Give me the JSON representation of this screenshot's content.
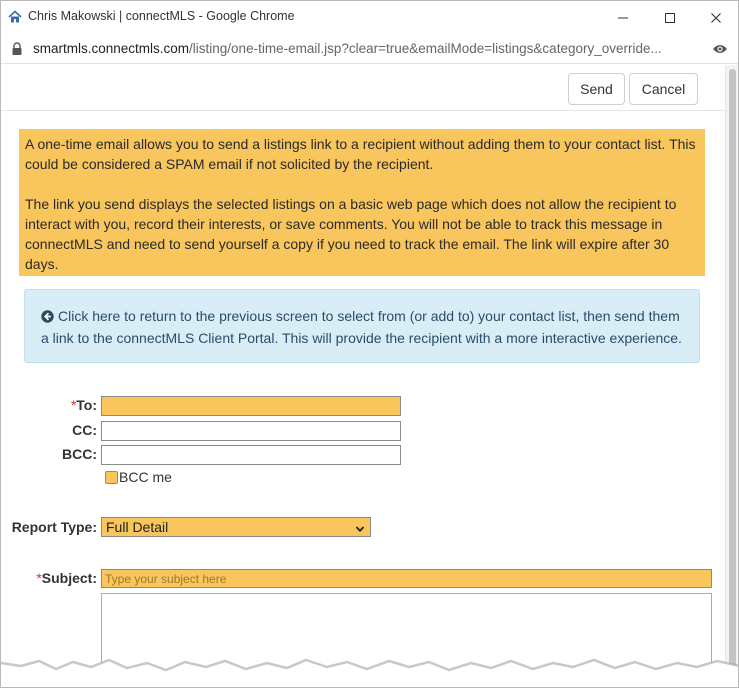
{
  "window": {
    "title": "Chris Makowski | connectMLS - Google Chrome"
  },
  "address": {
    "domain": "smartmls.connectmls.com",
    "path": "/listing/one-time-email.jsp?clear=true&emailMode=listings&category_override..."
  },
  "toolbar": {
    "send_label": "Send",
    "cancel_label": "Cancel"
  },
  "notice": {
    "paragraph1": "A one-time email allows you to send a listings link to a recipient without adding them to your contact list. This could be considered a SPAM email if not solicited by the recipient.",
    "paragraph2": "The link you send displays the selected listings on a basic web page which does not allow the recipient to interact with you, record their interests, or save comments. You will not be able to track this message in connectMLS and need to send yourself a copy if you need to track the email. The link will expire after 30 days."
  },
  "info": {
    "text": "Click here to return to the previous screen to select from (or add to) your contact list, then send them a link to the connectMLS Client Portal. This will provide the recipient with a more interactive experience."
  },
  "form": {
    "to_label": "To:",
    "cc_label": "CC:",
    "bcc_label": "BCC:",
    "required_mark": "*",
    "bcc_me_label": "BCC me",
    "report_type_label": "Report Type:",
    "report_type_value": "Full Detail",
    "subject_label": "Subject:",
    "subject_placeholder": "Type your subject here"
  },
  "colors": {
    "required_fill": "#f9c65d",
    "info_fill": "#d9edf7",
    "required_mark": "#d9302c"
  },
  "icons": {
    "app": "home-icon",
    "lock": "lock-icon",
    "view": "eye-icon",
    "info": "circle-arrow-left-icon",
    "select": "chevron-down-icon"
  }
}
